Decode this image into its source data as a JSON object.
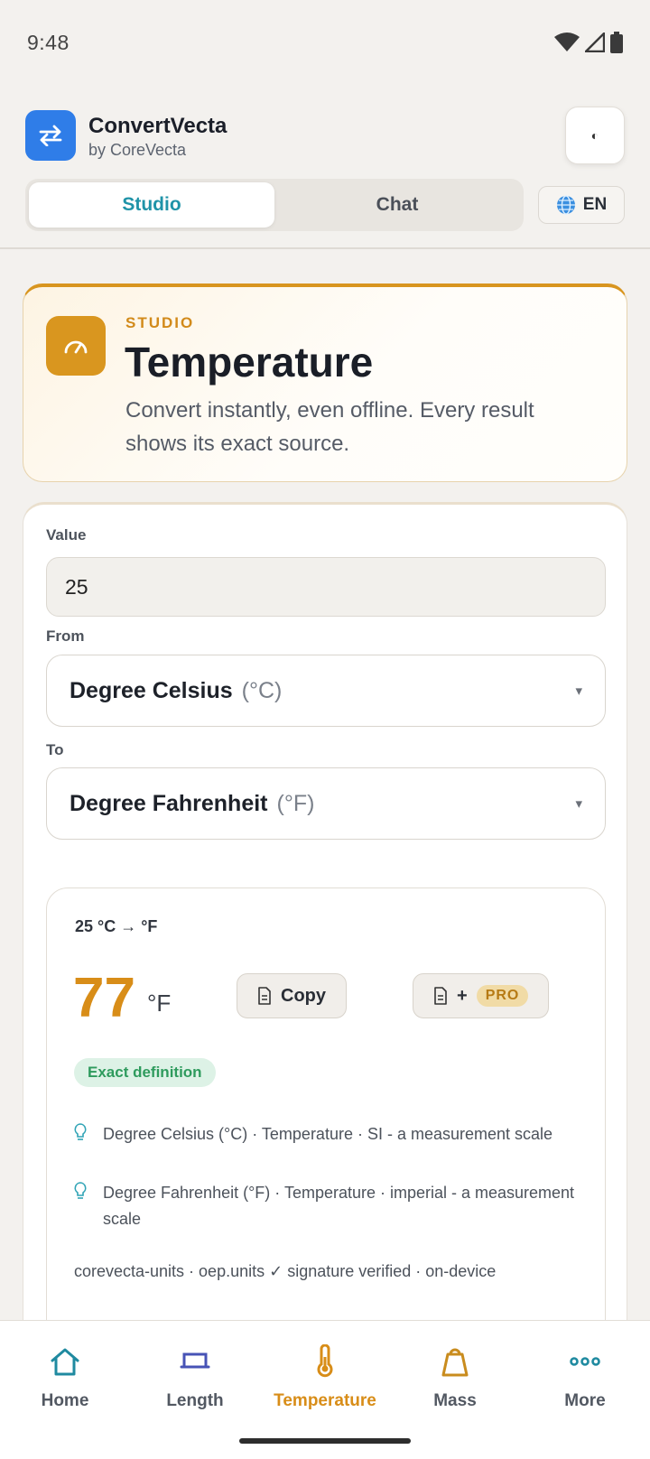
{
  "status": {
    "time": "9:48"
  },
  "app": {
    "name": "ConvertVecta",
    "subtitle": "by CoreVecta",
    "theme_icon": "◐",
    "tabs": [
      "Studio",
      "Chat"
    ],
    "active_tab": "Studio",
    "language": "EN"
  },
  "hero": {
    "eyebrow": "STUDIO",
    "title": "Temperature",
    "description": "Convert instantly, even offline. Every result shows its exact source."
  },
  "form": {
    "value_label": "Value",
    "value": "25",
    "from_label": "From",
    "from_unit_name": "Degree Celsius",
    "from_unit_symbol": "(°C)",
    "to_label": "To",
    "to_unit_name": "Degree Fahrenheit",
    "to_unit_symbol": "(°F)",
    "caret": "▾"
  },
  "result": {
    "heading": "25 °C → °F",
    "value": "77",
    "unit": "°F",
    "copy_label": "Copy",
    "add_label": "+",
    "pro_label": "PRO",
    "badge": "Exact definition",
    "sources": [
      "Degree Celsius (°C) · Temperature · SI - a measurement scale",
      "Degree Fahrenheit (°F) · Temperature · imperial - a measurement scale"
    ],
    "provenance": "corevecta-units · oep.units ✓ signature verified · on-device"
  },
  "nav": {
    "items": [
      "Home",
      "Length",
      "Temperature",
      "Mass",
      "More"
    ],
    "active": "Temperature"
  },
  "colors": {
    "accent": "#d88d18",
    "brand_blue": "#2f7de8",
    "teal": "#1f93a8",
    "success": "#2e9b5d"
  }
}
